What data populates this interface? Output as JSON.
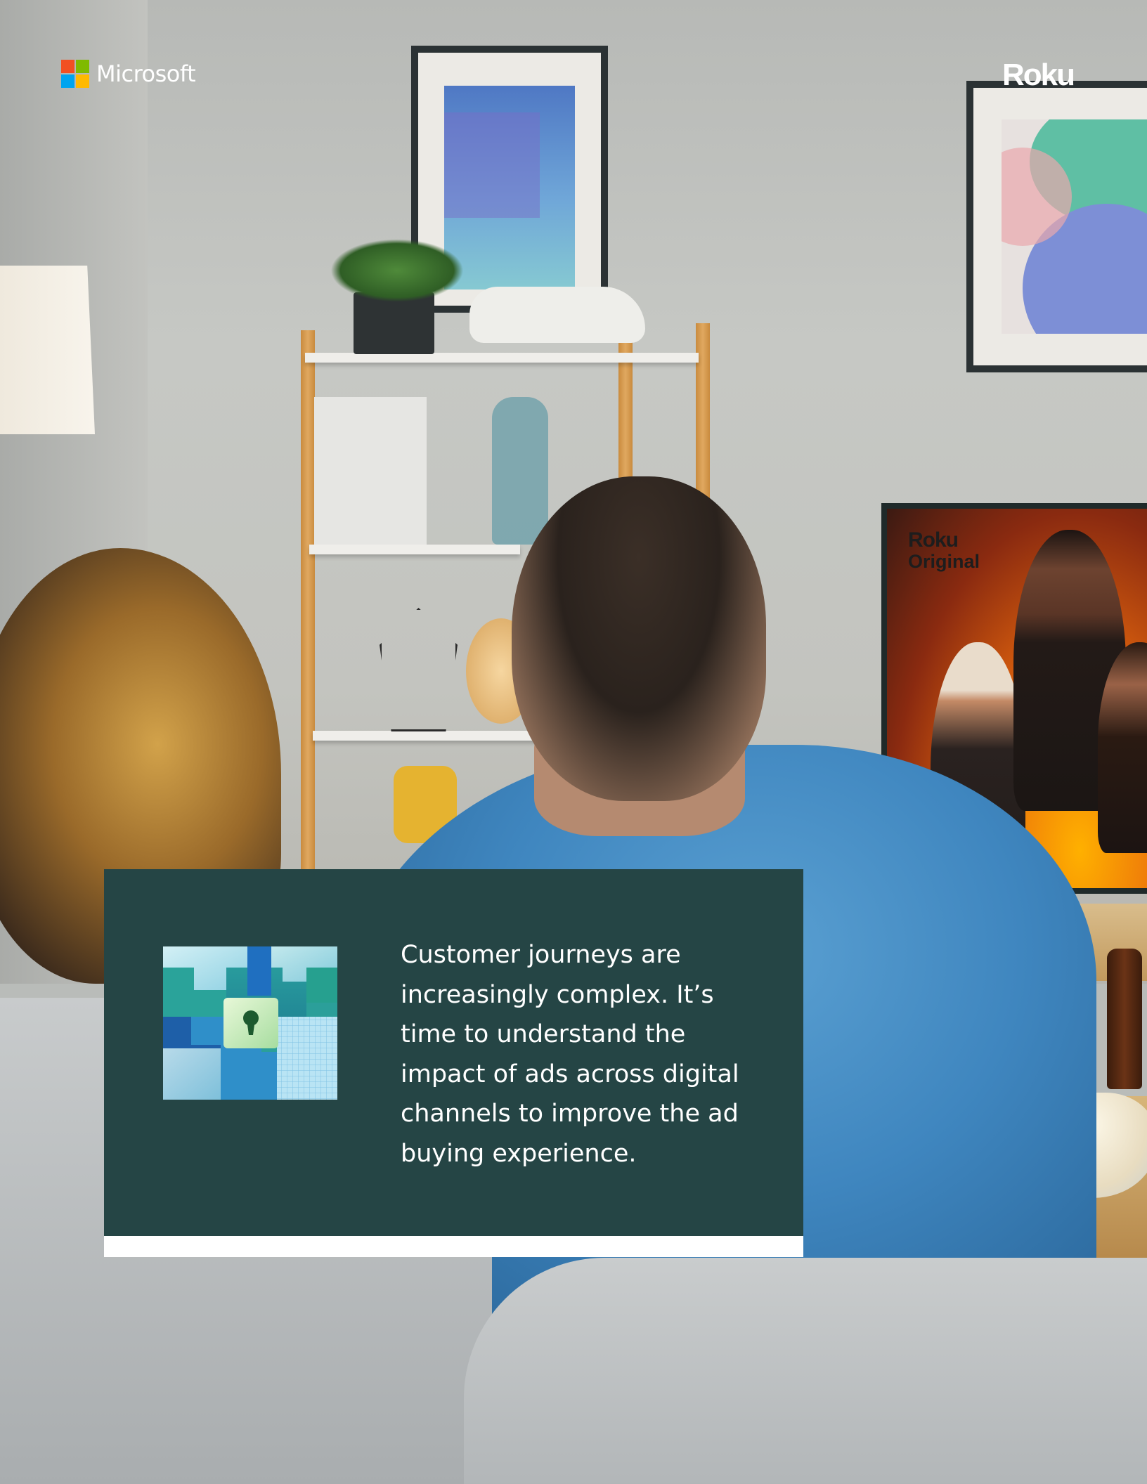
{
  "header": {
    "microsoft_logo_text": "Microsoft",
    "microsoft_logo_colors": [
      "#f25022",
      "#7fba00",
      "#00a4ef",
      "#ffb900"
    ],
    "roku_logo_text": "Roku"
  },
  "tv": {
    "logo_line1": "Roku",
    "logo_line2": "Original"
  },
  "callout": {
    "icon": "lock-puzzle-icon",
    "text": "Customer journeys are increasingly complex. It’s time to understand the impact of ads across digital channels to improve the ad buying experience.",
    "background_color": "#254545",
    "bar_color": "#ffffff"
  }
}
